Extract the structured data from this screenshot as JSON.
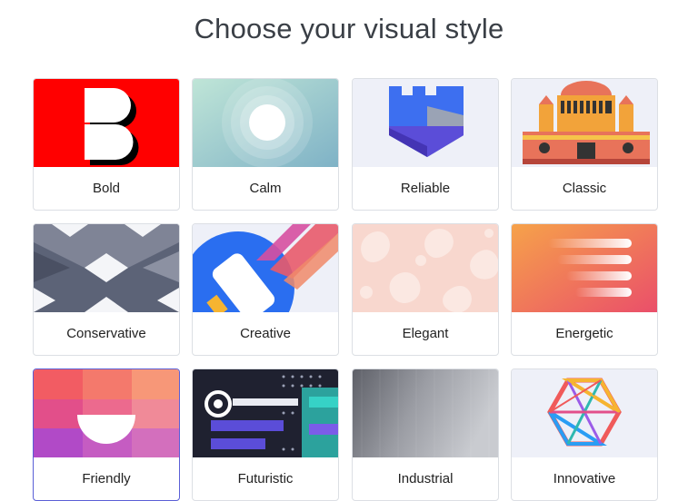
{
  "page": {
    "title": "Choose your visual style"
  },
  "styles": [
    {
      "label": "Bold"
    },
    {
      "label": "Calm"
    },
    {
      "label": "Reliable"
    },
    {
      "label": "Classic"
    },
    {
      "label": "Conservative"
    },
    {
      "label": "Creative"
    },
    {
      "label": "Elegant"
    },
    {
      "label": "Energetic"
    },
    {
      "label": "Friendly"
    },
    {
      "label": "Futuristic"
    },
    {
      "label": "Industrial"
    },
    {
      "label": "Innovative"
    }
  ],
  "colors": {
    "accent": "#5a5fd6",
    "text": "#222222",
    "border": "#dcdfe4",
    "bold_red": "#ff0000"
  },
  "selected_style": "Friendly"
}
